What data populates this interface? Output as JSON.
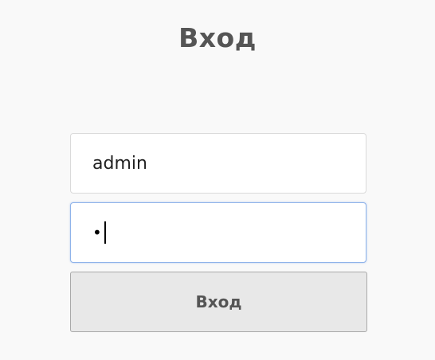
{
  "login": {
    "title": "Вход",
    "username_value": "admin",
    "password_masked": "•",
    "submit_label": "Вход"
  }
}
